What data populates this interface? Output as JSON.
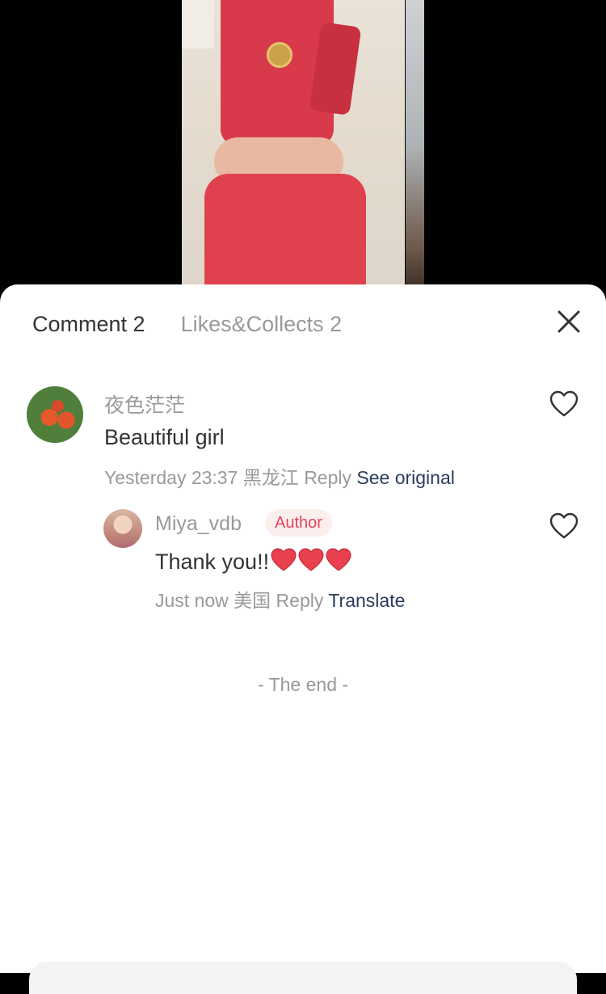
{
  "tabs": [
    {
      "label": "Comment 2"
    },
    {
      "label": "Likes&Collects 2"
    }
  ],
  "comments": [
    {
      "username": "夜色茫茫",
      "text": "Beautiful girl",
      "time": "Yesterday 23:37",
      "location": "黑龙江",
      "reply_label": "Reply",
      "action_label": "See original"
    }
  ],
  "reply": {
    "username": "Miya_vdb",
    "badge": "Author",
    "text": "Thank you!!",
    "time": "Just now",
    "location": "美国",
    "reply_label": "Reply",
    "action_label": "Translate"
  },
  "end_text": "- The end -",
  "colors": {
    "accent_link": "#2a3b5e",
    "badge_text": "#e0455a",
    "badge_bg": "#fdeeee"
  },
  "icons": [
    "close-icon",
    "heart-icon",
    "red-heart-emoji"
  ]
}
